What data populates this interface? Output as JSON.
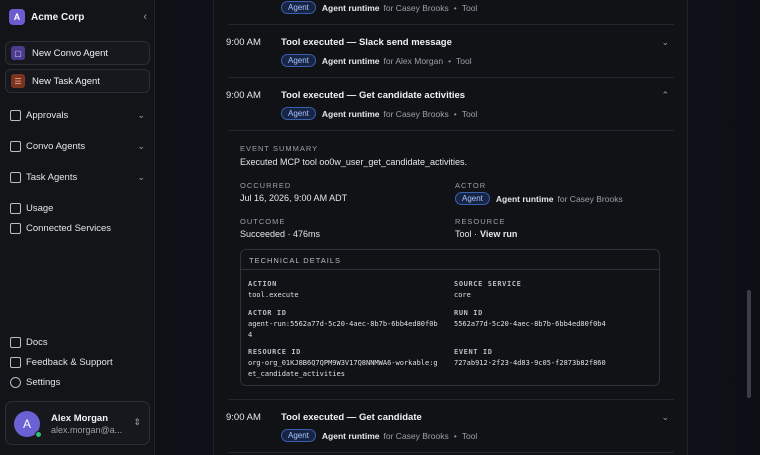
{
  "org": {
    "initial": "A",
    "name": "Acme Corp"
  },
  "sidebar": {
    "new_convo": "New Convo Agent",
    "new_task": "New Task Agent",
    "nav": [
      {
        "label": "Approvals"
      },
      {
        "label": "Convo Agents"
      },
      {
        "label": "Task Agents"
      },
      {
        "label": "Usage"
      },
      {
        "label": "Connected Services"
      }
    ],
    "footer": [
      {
        "label": "Docs"
      },
      {
        "label": "Feedback & Support"
      },
      {
        "label": "Settings"
      }
    ],
    "user": {
      "initial": "A",
      "name": "Alex Morgan",
      "email": "alex.morgan@a..."
    }
  },
  "events": [
    {
      "time": "",
      "title": "",
      "badge": "Agent",
      "actor": "Agent runtime",
      "for": "for Casey Brooks",
      "type": "Tool"
    },
    {
      "time": "9:00 AM",
      "title": "Tool executed — Slack send message",
      "badge": "Agent",
      "actor": "Agent runtime",
      "for": "for Alex Morgan",
      "type": "Tool"
    },
    {
      "time": "9:00 AM",
      "title": "Tool executed — Get candidate activities",
      "badge": "Agent",
      "actor": "Agent runtime",
      "for": "for Casey Brooks",
      "type": "Tool"
    },
    {
      "time": "9:00 AM",
      "title": "Tool executed — Get candidate",
      "badge": "Agent",
      "actor": "Agent runtime",
      "for": "for Casey Brooks",
      "type": "Tool"
    }
  ],
  "detail": {
    "summary_label": "EVENT SUMMARY",
    "summary": "Executed MCP tool oo0w_user_get_candidate_activities.",
    "occurred_label": "OCCURRED",
    "occurred": "Jul 16, 2026, 9:00 AM ADT",
    "actor_label": "ACTOR",
    "actor_badge": "Agent",
    "actor_name": "Agent runtime",
    "actor_for": "for Casey Brooks",
    "outcome_label": "OUTCOME",
    "outcome": "Succeeded · 476ms",
    "resource_label": "RESOURCE",
    "resource": "Tool ·",
    "view_run": "View run",
    "tech_label": "TECHNICAL DETAILS",
    "action_label": "ACTION",
    "action": "tool.execute",
    "source_label": "SOURCE SERVICE",
    "source": "core",
    "actor_id_label": "ACTOR ID",
    "actor_id_1": "agent-run:5562a77d-5c20-4aec-8b7b-6bb4ed80f0b",
    "actor_id_2": "4",
    "run_id_label": "RUN ID",
    "run_id": "5562a77d-5c20-4aec-8b7b-6bb4ed80f0b4",
    "resource_id_label": "RESOURCE ID",
    "resource_id_1": "org-org_01KJ8B6Q7QPM9W3V17Q8NNMWA6-workable:g",
    "resource_id_2": "et_candidate_activities",
    "event_id_label": "EVENT ID",
    "event_id": "727ab912-2f23-4d83-9c05-f2873b82f860"
  }
}
